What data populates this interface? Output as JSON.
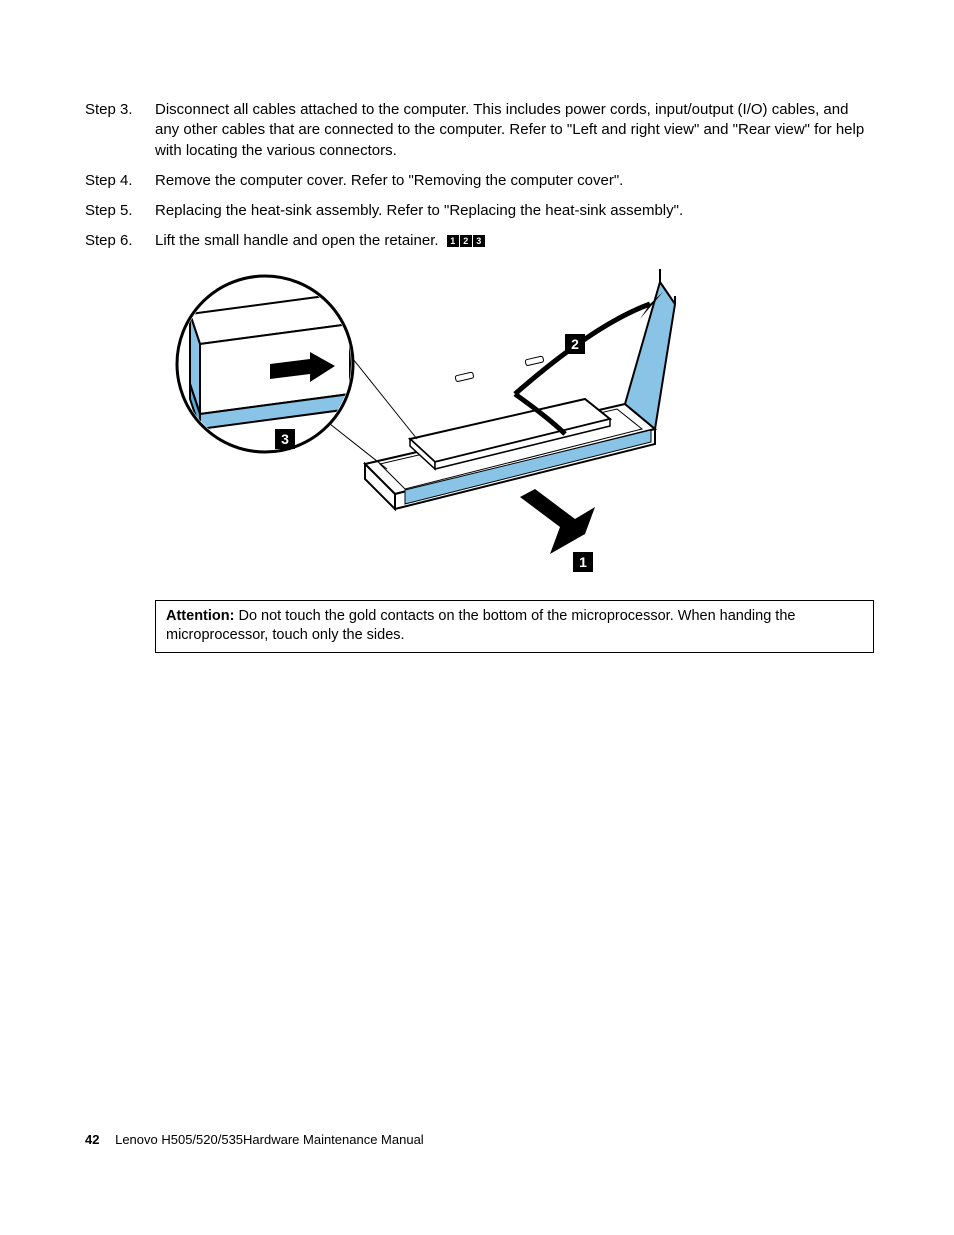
{
  "steps": [
    {
      "label": "Step 3.",
      "text": "Disconnect all cables attached to the computer. This includes power cords, input/output (I/O) cables, and any other cables that are connected to the computer. Refer to \"Left and right view\" and \"Rear view\" for help with locating the various connectors."
    },
    {
      "label": "Step 4.",
      "text": "Remove the computer cover. Refer to \"Removing the computer cover\"."
    },
    {
      "label": "Step 5.",
      "text": "Replacing the heat-sink assembly. Refer to \"Replacing the heat-sink assembly\"."
    },
    {
      "label": "Step 6.",
      "text": "Lift the small handle and open the retainer."
    }
  ],
  "inline_callouts": [
    "1",
    "2",
    "3"
  ],
  "figure_callouts": {
    "c1": "1",
    "c2": "2",
    "c3": "3"
  },
  "attention": {
    "label": "Attention:",
    "text": "Do not touch the gold contacts on the bottom of the microprocessor. When handing the microprocessor, touch only the sides."
  },
  "footer": {
    "page_number": "42",
    "title": "Lenovo H505/520/535Hardware Maintenance Manual"
  }
}
